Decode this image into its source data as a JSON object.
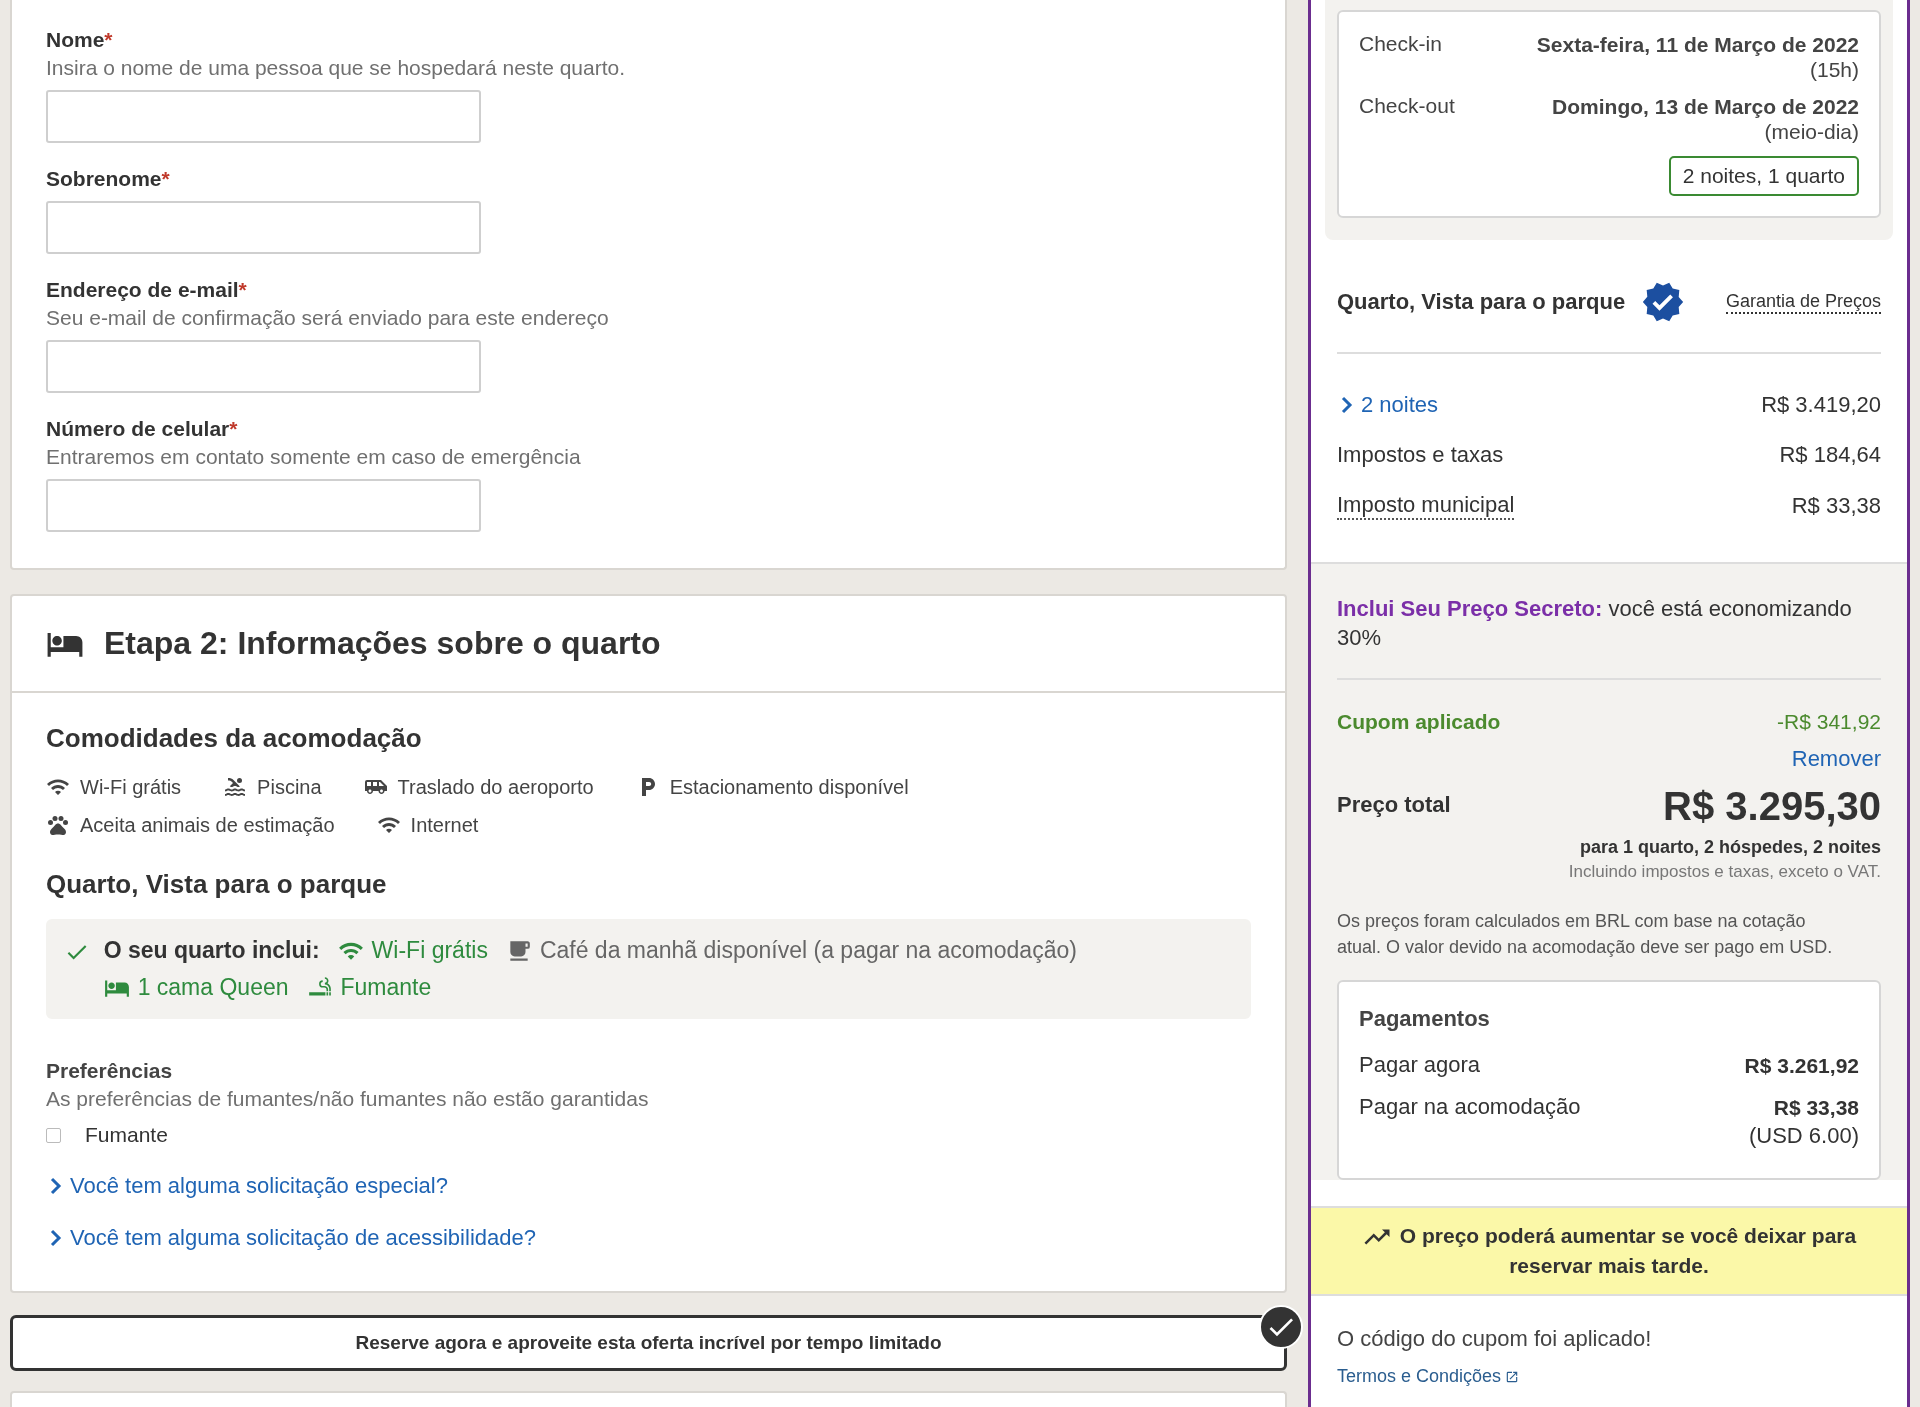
{
  "guest_form": {
    "fields": [
      {
        "label": "Nome",
        "required_mark": "*",
        "hint": "Insira o nome de uma pessoa que se hospedará neste quarto."
      },
      {
        "label": "Sobrenome",
        "required_mark": "*"
      },
      {
        "label": "Endereço de e-mail",
        "required_mark": "*",
        "hint": "Seu e-mail de confirmação será enviado para este endereço"
      },
      {
        "label": "Número de celular",
        "required_mark": "*",
        "hint": "Entraremos em contato somente em caso de emergência"
      }
    ]
  },
  "room_step": {
    "title": "Etapa 2: Informações sobre o quarto",
    "amenities_heading": "Comodidades da acomodação",
    "amenities": [
      {
        "kind": "wifi",
        "label": "Wi-Fi grátis"
      },
      {
        "kind": "pool",
        "label": "Piscina"
      },
      {
        "kind": "shuttle",
        "label": "Traslado do aeroporto"
      },
      {
        "kind": "parking",
        "label": "Estacionamento disponível"
      },
      {
        "kind": "pets",
        "label": "Aceita animais de estimação"
      },
      {
        "kind": "wifi",
        "label": "Internet"
      }
    ],
    "room_name": "Quarto, Vista para o parque",
    "includes": {
      "label": "O seu quarto inclui:",
      "items": [
        {
          "kind": "wifi",
          "label": "Wi-Fi grátis",
          "included": true
        },
        {
          "kind": "coffee",
          "label": "Café da manhã disponível (a pagar na acomodação)",
          "included": false
        },
        {
          "kind": "bed",
          "label": "1 cama Queen",
          "included": true
        },
        {
          "kind": "smoking",
          "label": "Fumante",
          "included": true
        }
      ]
    },
    "preferences": {
      "heading": "Preferências",
      "hint": "As preferências de fumantes/não fumantes não estão garantidas",
      "options": [
        {
          "label": "Fumante",
          "checked": false
        }
      ]
    },
    "requests": [
      {
        "label": "Você tem alguma solicitação especial?",
        "expanded": false
      },
      {
        "label": "Você tem alguma solicitação de acessibilidade?",
        "expanded": false
      }
    ]
  },
  "offer_banner": {
    "text": "Reserve agora e aproveite esta oferta incrível por tempo limitado"
  },
  "summary": {
    "stay": {
      "rows": [
        {
          "label": "Check-in",
          "date": "Sexta-feira, 11 de Março de 2022",
          "time": "(15h)"
        },
        {
          "label": "Check-out",
          "date": "Domingo, 13 de Março de 2022",
          "time": "(meio-dia)"
        }
      ],
      "duration": "2 noites, 1 quarto"
    },
    "room": {
      "title": "Quarto, Vista para o parque",
      "guarantee": "Garantia de Preços"
    },
    "price_lines": [
      {
        "kind": "expandable",
        "label": "2 noites",
        "amount": "R$ 3.419,20",
        "expanded": false
      },
      {
        "kind": "plain",
        "label": "Impostos e taxas",
        "amount": "R$ 184,64"
      },
      {
        "kind": "tooltip",
        "label": "Imposto municipal",
        "amount": "R$ 33,38"
      }
    ],
    "secret_price": {
      "highlight": "Inclui Seu Preço Secreto:",
      "text": "você está economizando 30%"
    },
    "coupon": {
      "label": "Cupom aplicado",
      "amount": "-R$ 341,92",
      "action": "Remover"
    },
    "total": {
      "label": "Preço total",
      "amount": "R$ 3.295,30",
      "basis": "para 1 quarto, 2 hóspedes, 2 noites",
      "tax_note": "Incluindo impostos e taxas, exceto o VAT."
    },
    "currency_note": "Os preços foram calculados em BRL com base na cotação atual. O valor devido na acomodação deve ser pago em USD.",
    "payments": {
      "title": "Pagamentos",
      "rows": [
        {
          "label": "Pagar agora",
          "amount": "R$ 3.261,92"
        },
        {
          "label": "Pagar na acomodação",
          "amount": "R$ 33,38",
          "secondary": "(USD 6.00)"
        }
      ]
    },
    "price_alert": "O preço poderá aumentar se você deixar para reservar mais tarde.",
    "coupon_footer": {
      "message": "O código do cupom foi aplicado!",
      "terms_link": "Termos e Condições"
    }
  }
}
